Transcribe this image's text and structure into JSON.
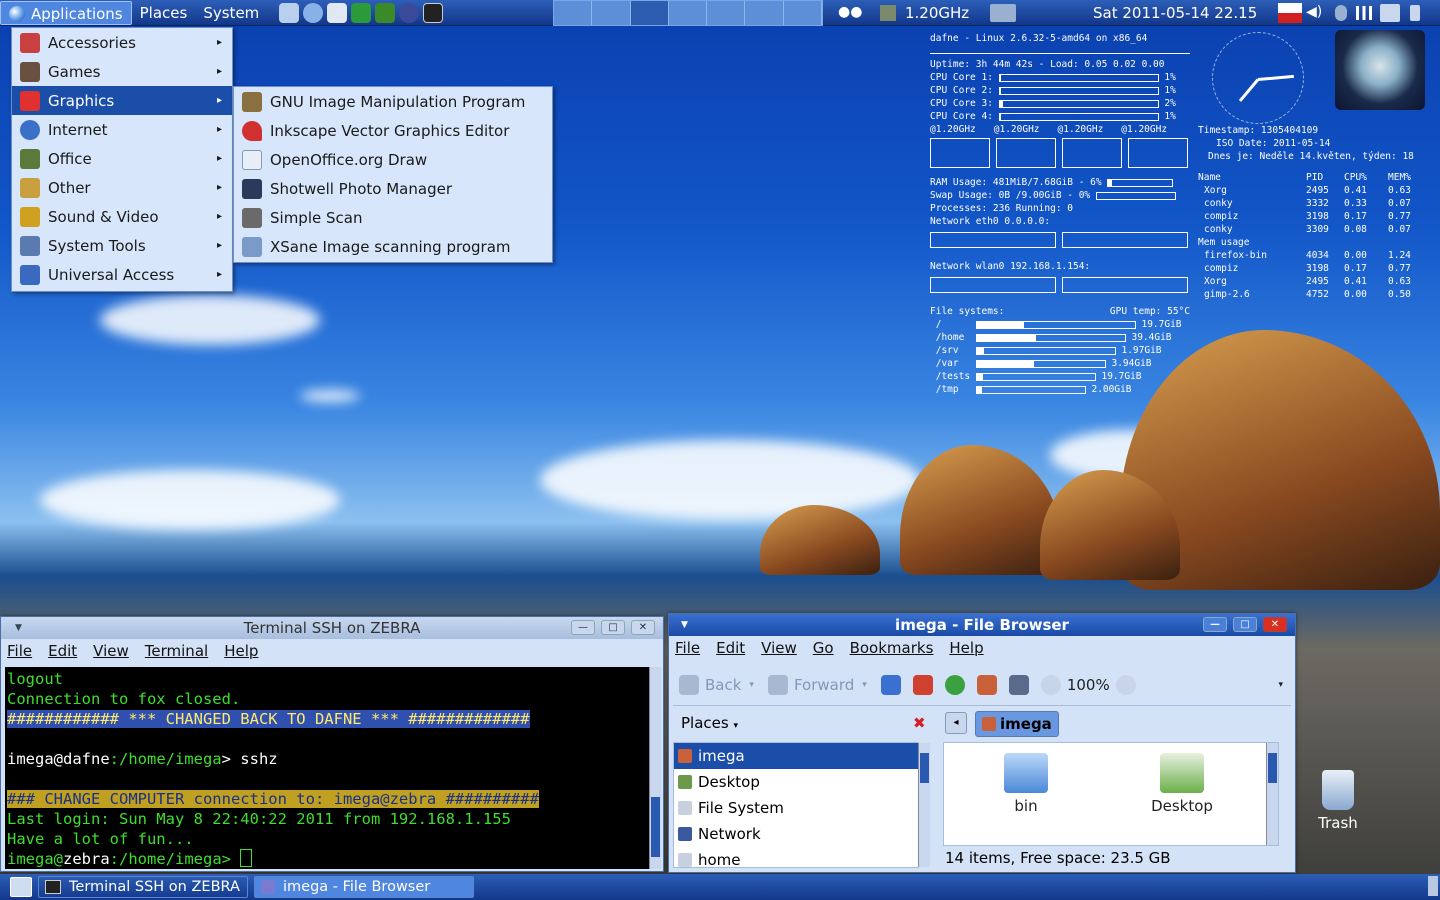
{
  "panel": {
    "menus": [
      "Applications",
      "Places",
      "System"
    ],
    "cpu_freq": "1.20GHz",
    "clock": "Sat 2011-05-14 22.15"
  },
  "applications_menu": {
    "items": [
      {
        "label": "Accessories"
      },
      {
        "label": "Games"
      },
      {
        "label": "Graphics",
        "selected": true
      },
      {
        "label": "Internet"
      },
      {
        "label": "Office"
      },
      {
        "label": "Other"
      },
      {
        "label": "Sound & Video"
      },
      {
        "label": "System Tools"
      },
      {
        "label": "Universal Access"
      }
    ],
    "graphics_submenu": [
      "GNU Image Manipulation Program",
      "Inkscape Vector Graphics Editor",
      "OpenOffice.org Draw",
      "Shotwell Photo Manager",
      "Simple Scan",
      "XSane Image scanning program"
    ]
  },
  "conky": {
    "header": "dafne - Linux 2.6.32-5-amd64 on x86_64",
    "uptime": "Uptime: 3h 44m 42s - Load: 0.05 0.02 0.00",
    "cores": [
      {
        "label": "CPU Core 1:",
        "value": "1%",
        "level": 0.01
      },
      {
        "label": "CPU Core 2:",
        "value": "1%",
        "level": 0.01
      },
      {
        "label": "CPU Core 3:",
        "value": "2%",
        "level": 0.02
      },
      {
        "label": "CPU Core 4:",
        "value": "1%",
        "level": 0.01
      }
    ],
    "freqs": [
      "@1.20GHz",
      "@1.20GHz",
      "@1.20GHz",
      "@1.20GHz"
    ],
    "ram": "RAM Usage: 481MiB/7.68GiB - 6%",
    "swap": "Swap Usage: 0B /9.00GiB - 0%",
    "processes": "Processes: 236 Running: 0",
    "eth0": "Network eth0 0.0.0.0:",
    "wlan0": "Network wlan0 192.168.1.154:",
    "fs_label": "File systems:",
    "gpu_temp": "GPU temp: 55°C",
    "filesystems": [
      {
        "mount": "/",
        "size": "19.7GiB",
        "level": 0.3
      },
      {
        "mount": "/home",
        "size": "39.4GiB",
        "level": 0.4
      },
      {
        "mount": "/srv",
        "size": "1.97GiB",
        "level": 0.05
      },
      {
        "mount": "/var",
        "size": "3.94GiB",
        "level": 0.45
      },
      {
        "mount": "/tests",
        "size": "19.7GiB",
        "level": 0.05
      },
      {
        "mount": "/tmp",
        "size": "2.00GiB",
        "level": 0.05
      }
    ],
    "timestamp": "Timestamp: 1305404109",
    "iso_date": "ISO Date: 2011-05-14",
    "dnes": "Dnes je: Neděle 14.květen, týden: 18",
    "proc_header": [
      "Name",
      "PID",
      "CPU%",
      "MEM%"
    ],
    "top_cpu": [
      [
        "Xorg",
        "2495",
        "0.41",
        "0.63"
      ],
      [
        "conky",
        "3332",
        "0.33",
        "0.07"
      ],
      [
        "compiz",
        "3198",
        "0.17",
        "0.77"
      ],
      [
        "conky",
        "3309",
        "0.08",
        "0.07"
      ]
    ],
    "mem_label": "Mem usage",
    "top_mem": [
      [
        "firefox-bin",
        "4034",
        "0.00",
        "1.24"
      ],
      [
        "compiz",
        "3198",
        "0.17",
        "0.77"
      ],
      [
        "Xorg",
        "2495",
        "0.41",
        "0.63"
      ],
      [
        "gimp-2.6",
        "4752",
        "0.00",
        "0.50"
      ]
    ]
  },
  "terminal": {
    "title": "Terminal SSH on ZEBRA",
    "menu": [
      "File",
      "Edit",
      "View",
      "Terminal",
      "Help"
    ],
    "lines": {
      "l1": "logout",
      "l2": "Connection to fox closed.",
      "l3": "############ *** CHANGED BACK TO DAFNE *** #############",
      "l4_user": "imega@dafne",
      "l4_path": ":/home/imega",
      "l4_cmd": "> sshz",
      "l5": " ### CHANGE COMPUTER connection to: imega@zebra ##########",
      "l6": "Last login: Sun May  8 22:40:22 2011 from 192.168.1.155",
      "l7": "Have a lot of fun...",
      "l8_user": "imega@",
      "l8_host": "zebra",
      "l8_path": ":/home/imega>"
    }
  },
  "file_browser": {
    "title": "imega - File Browser",
    "menu": [
      "File",
      "Edit",
      "View",
      "Go",
      "Bookmarks",
      "Help"
    ],
    "back": "Back",
    "forward": "Forward",
    "zoom": "100%",
    "places_label": "Places",
    "location": "imega",
    "places": [
      "imega",
      "Desktop",
      "File System",
      "Network",
      "home"
    ],
    "icons": [
      "bin",
      "Desktop"
    ],
    "status": "14 items, Free space: 23.5 GB"
  },
  "taskbar": {
    "tasks": [
      "Terminal SSH on ZEBRA",
      "imega - File Browser"
    ]
  },
  "desktop": {
    "trash": "Trash"
  }
}
